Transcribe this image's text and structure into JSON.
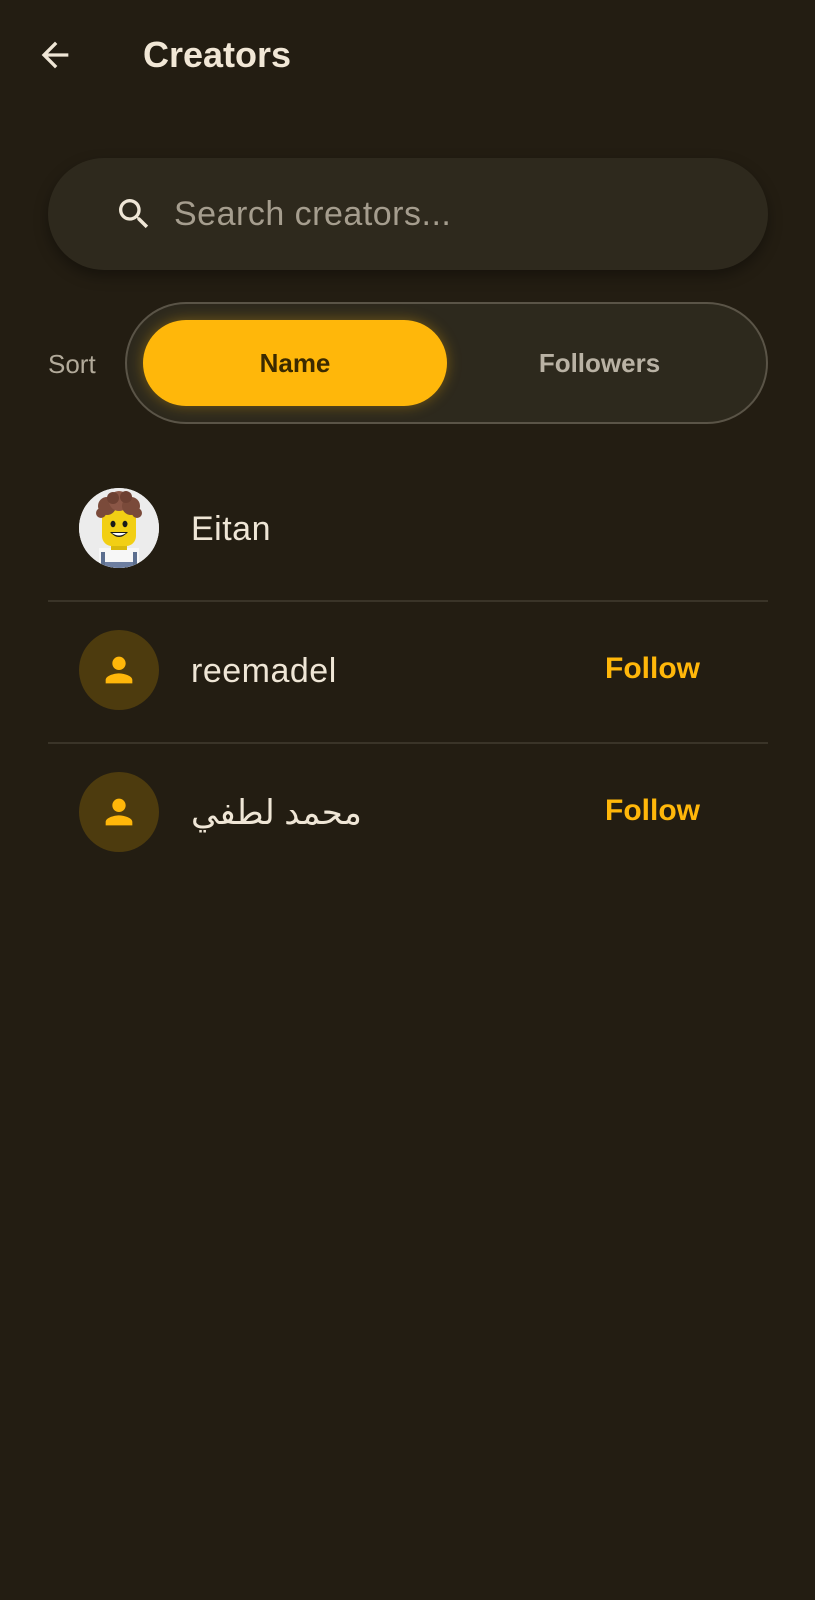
{
  "header": {
    "title": "Creators",
    "back_icon": "arrow-back-icon"
  },
  "search": {
    "placeholder": "Search creators...",
    "value": "",
    "icon": "search-icon"
  },
  "sort": {
    "label": "Sort",
    "options": [
      {
        "label": "Name",
        "selected": true
      },
      {
        "label": "Followers",
        "selected": false
      }
    ]
  },
  "creators": [
    {
      "name": "Eitan",
      "avatar": "photo",
      "follow_label": ""
    },
    {
      "name": "reemadel",
      "avatar": "person-icon",
      "follow_label": "Follow"
    },
    {
      "name": "محمد لطفي",
      "avatar": "person-icon",
      "follow_label": "Follow"
    }
  ],
  "colors": {
    "background": "#231d12",
    "surface": "#2e291d",
    "accent": "#ffb70a",
    "text": "#efe6d6",
    "muted": "#a59d8e",
    "avatar_bg": "#4d3b0e"
  }
}
